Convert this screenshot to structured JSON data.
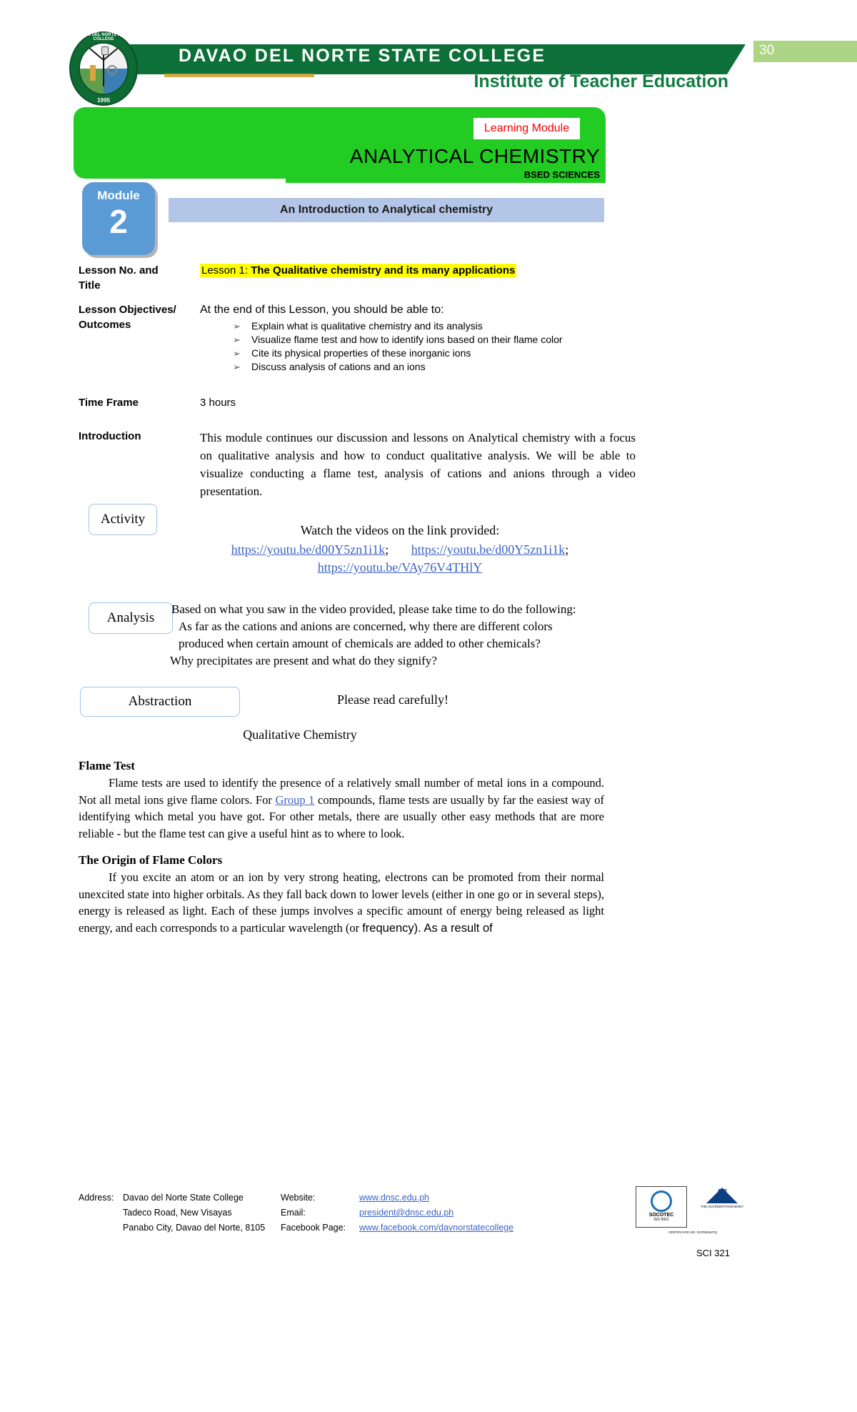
{
  "header": {
    "institution": "DAVAO DEL NORTE STATE COLLEGE",
    "department": "Institute of Teacher Education",
    "page_number": "30",
    "seal_top_text": "DAVAO DEL NORTE STATE COLLEGE",
    "seal_year": "1995",
    "seal_icon": "college-seal-icon"
  },
  "banner": {
    "badge": "Learning Module",
    "title": "ANALYTICAL  CHEMISTRY",
    "program": "BSED SCIENCES"
  },
  "module": {
    "word": "Module",
    "number": "2",
    "lesson_bar": "An Introduction to Analytical chemistry"
  },
  "meta": {
    "lesson_label_line1": "Lesson No. and",
    "lesson_label_line2": "Title",
    "lesson_prefix": "Lesson 1:",
    "lesson_title": " The Qualitative  chemistry and its many applications",
    "objectives_label_line1": "Lesson Objectives/",
    "objectives_label_line2": "Outcomes",
    "objectives_lead": "At the end of this Lesson,  you  should be able to:",
    "objectives": [
      "Explain what is qualitative chemistry and its analysis",
      "Visualize flame test and how to identify ions based on their flame color",
      "Cite its physical properties of these inorganic ions",
      "Discuss analysis of cations and an ions"
    ],
    "bullet_glyph": "➢",
    "time_frame_label": "Time Frame",
    "time_frame_value": "3 hours",
    "introduction_label": "Introduction",
    "introduction_text": "This module continues our discussion and lessons on Analytical chemistry with a focus on qualitative analysis and how to conduct qualitative analysis. We will be able to visualize  conducting a flame test, analysis of cations and anions through a video presentation."
  },
  "activity": {
    "box_label": "Activity",
    "lead": "Watch the videos on the link provided:",
    "link1": "https://youtu.be/d00Y5zn1i1k",
    "link1_sep": ";",
    "link2": "https://youtu.be/d00Y5zn1i1k",
    "link2_sep": ";",
    "link3": "https://youtu.be/VAy76V4THlY"
  },
  "analysis": {
    "box_label": "Analysis",
    "line1": "Based on what you saw in the video provided, please take time to do the following:",
    "line2": "As far as the cations and anions are concerned, why there are different colors",
    "line3": "produced when certain amount of chemicals are added to other chemicals?",
    "line4": "Why precipitates are present and what do they signify?"
  },
  "abstraction": {
    "box_label": "Abstraction",
    "instruction": "Please read carefully!",
    "topic": "Qualitative   Chemistry"
  },
  "body": {
    "flame_test_heading": "Flame Test",
    "flame_test_p1a": "Flame tests are used to identify the presence of a relatively small number of metal ions in a compound. Not all metal ions give flame colors. For ",
    "flame_test_link": "Group 1",
    "flame_test_p1b": " compounds, flame tests are usually by far the easiest way of identifying which metal you have got. For other metals, there are usually other easy methods that are more reliable - but the flame test can give a useful hint as to where to look.",
    "origin_heading": "The Origin of Flame Colors",
    "origin_p1a": "If you excite an atom or an ion by very strong heating, electrons can be promoted from their normal unexcited state into higher orbitals. As they fall back down to lower levels (either in one go or in several steps), energy is released as light. Each of these jumps involves a specific amount of energy being released as light energy, and each corresponds to a particular wavelength (or ",
    "origin_p1b": "frequency). As a result of"
  },
  "footer": {
    "address_label": "Address:",
    "address_line1": "Davao del Norte State College",
    "address_line2": "Tadeco Road, New Visayas",
    "address_line3": "Panabo City, Davao del Norte, 8105",
    "website_label": "Website:",
    "website_value": "www.dnsc.edu.ph",
    "email_label": "Email:",
    "email_value": "president@dnsc.edu.ph",
    "facebook_label": "Facebook Page:",
    "facebook_value": "www.facebook.com/davnorstatecollege",
    "course_code": "SCI 321",
    "cert1_name": "SOCOTEC",
    "cert1_standard": "ISO 9001",
    "cert2_name": "AB",
    "cert2_sub": "THE ACCREDITATION BODY",
    "cert_note": "CERTIFICATE NO. GCP002427Q"
  },
  "colors": {
    "header_green": "#0d7038",
    "dept_green": "#107c41",
    "banner_green": "#22cc22",
    "page_band": "#aed486",
    "module_blue": "#5b9bd5",
    "lesson_bar_blue": "#b4c6e7",
    "highlight_yellow": "#ffff00",
    "badge_red": "#ff0000",
    "link_blue": "#3b63c4",
    "callout_border": "#9dc3e6"
  }
}
